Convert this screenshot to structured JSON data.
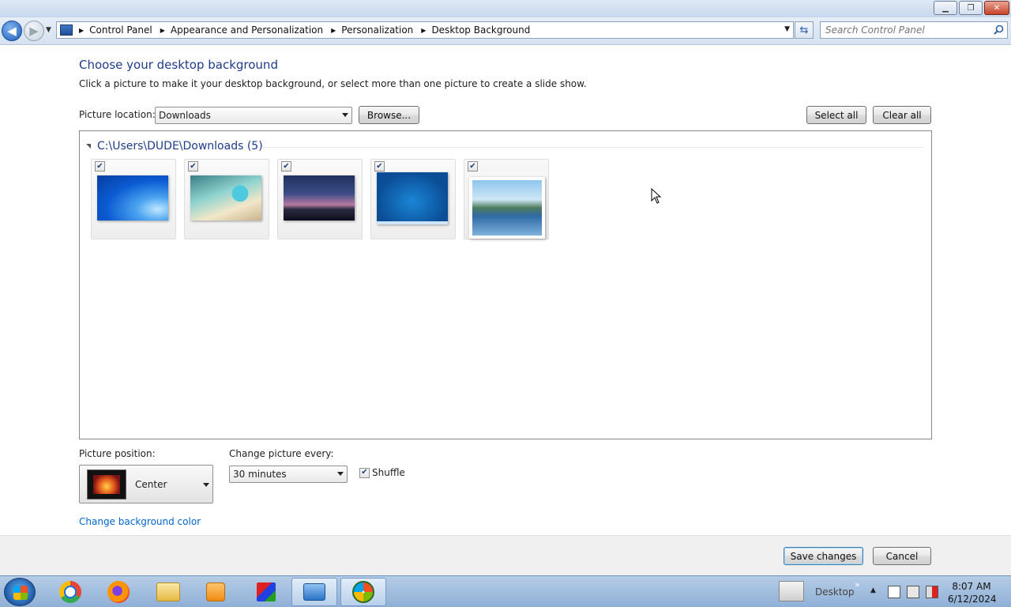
{
  "window": {
    "minimize_icon": "minimize-icon",
    "restore_icon": "restore-icon",
    "close_icon": "close-icon"
  },
  "address": {
    "breadcrumbs": [
      "Control Panel",
      "Appearance and Personalization",
      "Personalization",
      "Desktop Background"
    ]
  },
  "search": {
    "placeholder": "Search Control Panel"
  },
  "main": {
    "heading": "Choose your desktop background",
    "subtext": "Click a picture to make it your desktop background, or select more than one picture to create a slide show.",
    "picture_location_label": "Picture location:",
    "picture_location_value": "Downloads",
    "browse_label": "Browse...",
    "select_all_label": "Select all",
    "clear_all_label": "Clear all",
    "group_title": "C:\\Users\\DUDE\\Downloads (5)",
    "thumbnails": [
      {
        "checked": true,
        "subject": "blue-abstract-wallpaper"
      },
      {
        "checked": true,
        "subject": "cartoon-character-wallpaper"
      },
      {
        "checked": true,
        "subject": "sunset-pier-wallpaper"
      },
      {
        "checked": true,
        "subject": "blue-desktop-screenshot"
      },
      {
        "checked": true,
        "subject": "coastline-landscape-wallpaper"
      }
    ],
    "picture_position_label": "Picture position:",
    "picture_position_value": "Center",
    "change_every_label": "Change picture every:",
    "change_every_value": "30 minutes",
    "shuffle_label": "Shuffle",
    "shuffle_checked": true,
    "bg_color_link": "Change background color"
  },
  "footer": {
    "save_label": "Save changes",
    "cancel_label": "Cancel"
  },
  "taskbar": {
    "apps": [
      "chrome-icon",
      "firefox-icon",
      "file-explorer-icon",
      "media-player-icon",
      "paint-3d-icon",
      "control-panel-icon",
      "windows-orb-icon"
    ],
    "desktop_label": "Desktop",
    "time": "8:07 AM",
    "date": "6/12/2024"
  },
  "colors": {
    "heading": "#1e3c87",
    "link": "#0066cc",
    "taskbar": "#9db9dc"
  }
}
